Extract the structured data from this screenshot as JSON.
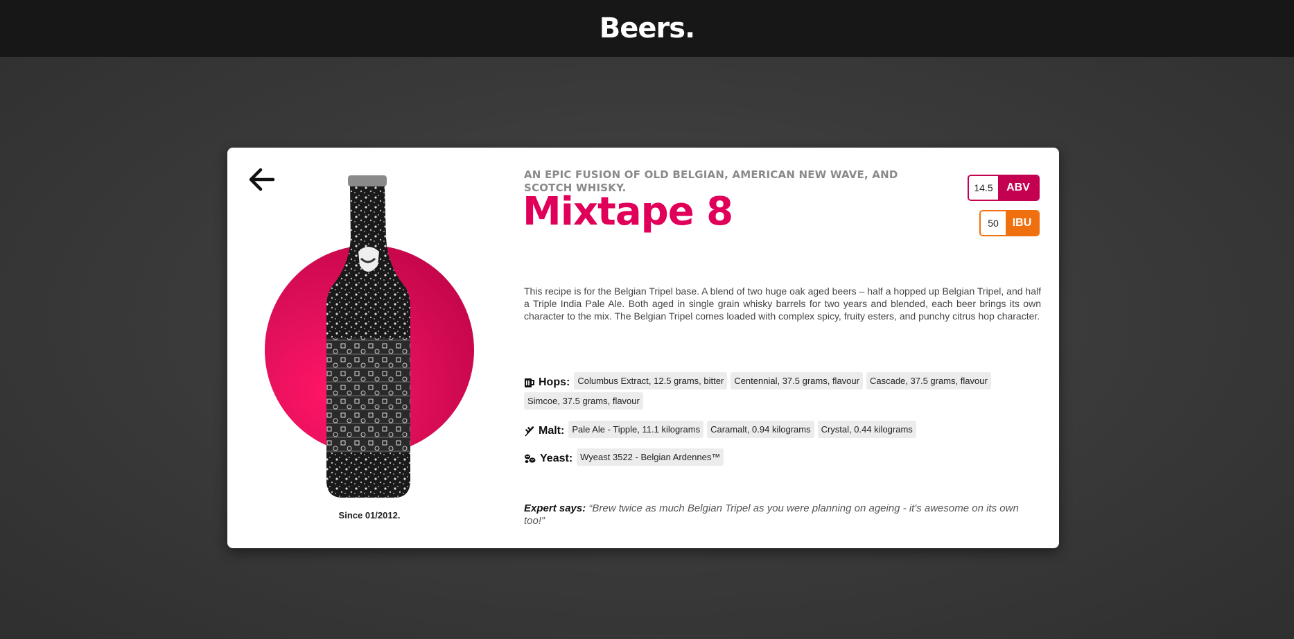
{
  "header": {
    "brand": "Beers."
  },
  "beer": {
    "tagline": "An Epic Fusion Of Old Belgian, American New Wave, And Scotch Whisky.",
    "name": "Mixtape 8",
    "since": "Since 01/2012.",
    "abv": {
      "value": "14.5",
      "label": "ABV",
      "color": "#c40050"
    },
    "ibu": {
      "value": "50",
      "label": "IBU",
      "color": "#f07010"
    },
    "description": "This recipe is for the Belgian Tripel base. A blend of two huge oak aged beers – half a hopped up Belgian Tripel, and half a Triple India Pale Ale. Both aged in single grain whisky barrels for two years and blended, each beer brings its own character to the mix. The Belgian Tripel comes loaded with complex spicy, fruity esters, and punchy citrus hop character.",
    "hops_label": "Hops:",
    "hops": [
      "Columbus Extract, 12.5 grams, bitter",
      "Centennial, 37.5 grams, flavour",
      "Cascade, 37.5 grams, flavour",
      "Simcoe, 37.5 grams, flavour"
    ],
    "malt_label": "Malt:",
    "malt": [
      "Pale Ale - Tipple, 11.1 kilograms",
      "Caramalt, 0.94 kilograms",
      "Crystal, 0.44 kilograms"
    ],
    "yeast_label": "Yeast:",
    "yeast": [
      "Wyeast 3522 - Belgian Ardennes™"
    ],
    "expert_label": "Expert says:",
    "expert_quote": "“Brew twice as much Belgian Tripel as you were planning on ageing - it's awesome on its own too!”"
  },
  "icons": {
    "back": "arrow-left-icon",
    "hops": "beer-mug-icon",
    "malt": "wheat-icon",
    "yeast": "yeast-icon"
  },
  "colors": {
    "accent": "#e0005a",
    "circle": "#e0105a"
  }
}
